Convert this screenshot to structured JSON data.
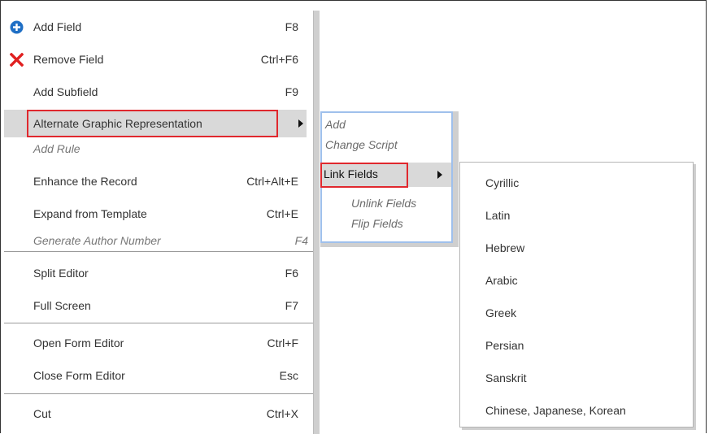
{
  "main_menu": {
    "add_field": {
      "label": "Add Field",
      "shortcut": "F8",
      "icon": "plus-circle-icon"
    },
    "remove_field": {
      "label": "Remove Field",
      "shortcut": "Ctrl+F6",
      "icon": "red-x-icon"
    },
    "add_subfield": {
      "label": "Add Subfield",
      "shortcut": "F9"
    },
    "alternate_graphic": {
      "label": "Alternate Graphic Representation"
    },
    "add_rule": {
      "label": "Add Rule"
    },
    "enhance_record": {
      "label": "Enhance the Record",
      "shortcut": "Ctrl+Alt+E"
    },
    "expand_template": {
      "label": "Expand from Template",
      "shortcut": "Ctrl+E"
    },
    "generate_author": {
      "label": "Generate Author Number",
      "shortcut": "F4"
    },
    "split_editor": {
      "label": "Split Editor",
      "shortcut": "F6"
    },
    "full_screen": {
      "label": "Full Screen",
      "shortcut": "F7"
    },
    "open_form_editor": {
      "label": "Open Form Editor",
      "shortcut": "Ctrl+F"
    },
    "close_form_editor": {
      "label": "Close Form Editor",
      "shortcut": "Esc"
    },
    "cut": {
      "label": "Cut",
      "shortcut": "Ctrl+X"
    }
  },
  "submenu_alt_graphic": {
    "add": "Add",
    "change_script": "Change Script",
    "link_fields": "Link Fields",
    "unlink_fields": "Unlink Fields",
    "flip_fields": "Flip Fields"
  },
  "submenu_link_fields": {
    "items": [
      "Cyrillic",
      "Latin",
      "Hebrew",
      "Arabic",
      "Greek",
      "Persian",
      "Sanskrit",
      "Chinese, Japanese, Korean"
    ]
  },
  "colors": {
    "highlight_border": "#e0282e",
    "submenu_border": "#9fc0ec",
    "icon_blue": "#1f6fc5",
    "icon_red": "#e02020"
  }
}
